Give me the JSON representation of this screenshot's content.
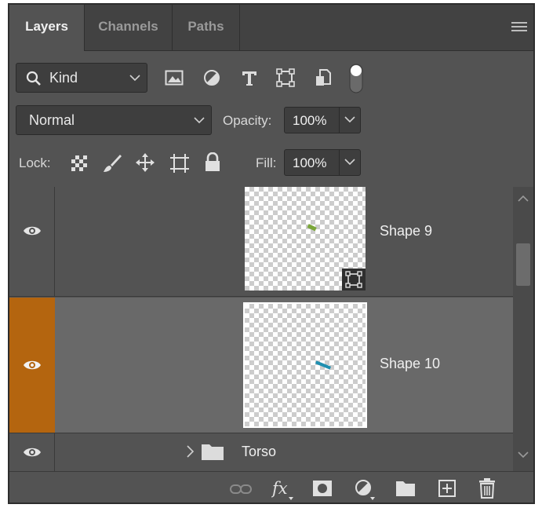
{
  "tabs": [
    {
      "label": "Layers",
      "active": true
    },
    {
      "label": "Channels",
      "active": false
    },
    {
      "label": "Paths",
      "active": false
    }
  ],
  "filter": {
    "kind_label": "Kind",
    "icons": [
      "image-filter-icon",
      "adjustment-filter-icon",
      "type-filter-icon",
      "shape-filter-icon",
      "smart-object-filter-icon",
      "filter-toggle-switch"
    ]
  },
  "blend": {
    "mode": "Normal",
    "opacity_label": "Opacity:",
    "opacity_value": "100%"
  },
  "lock": {
    "label": "Lock:",
    "fill_label": "Fill:",
    "fill_value": "100%"
  },
  "layers": [
    {
      "name": "Shape 9",
      "visible": true,
      "selected": false
    },
    {
      "name": "Shape 10",
      "visible": true,
      "selected": true
    },
    {
      "name": "Torso",
      "visible": true,
      "selected": false,
      "type": "group"
    }
  ],
  "colors": {
    "accent": "#b4650f",
    "panel": "#535353",
    "selected_row": "#696969"
  }
}
